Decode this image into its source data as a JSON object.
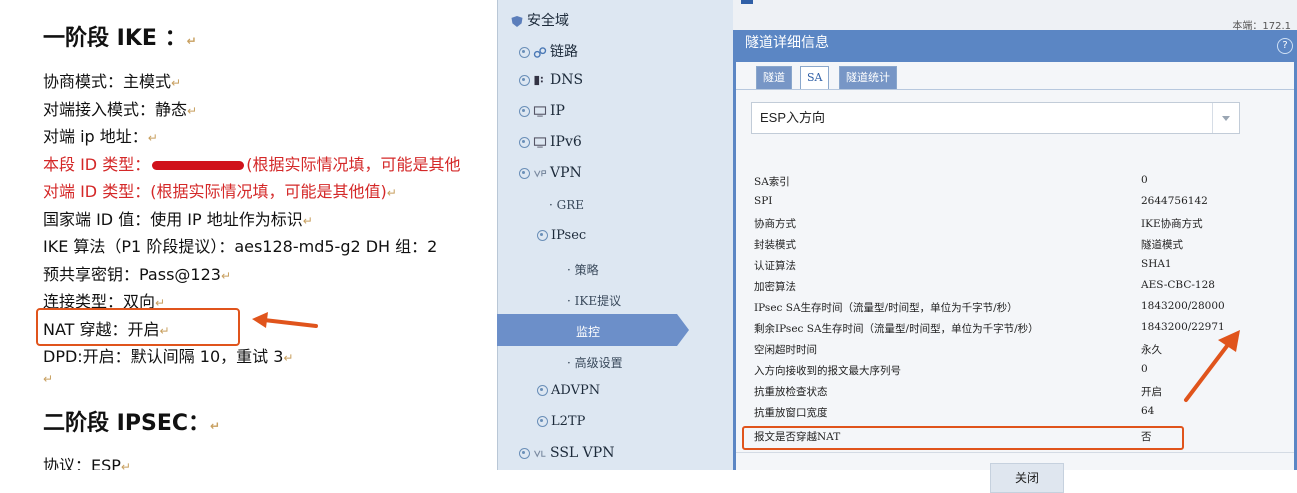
{
  "document": {
    "heading1": "一阶段 IKE ：",
    "lines": [
      "协商模式：主模式",
      "对端接入模式：静态",
      "对端 ip 地址：",
      "本段 ID 类型：",
      "(根据实际情况填，可能是其他",
      "对端 ID 类型：(根据实际情况填，可能是其他值)",
      "国家端 ID 值：使用 IP 地址作为标识",
      "IKE 算法（P1 阶段提议）：aes128-md5-g2   DH 组：2",
      "预共享密钥：Pass@123",
      "连接类型：双向",
      "NAT 穿越：开启",
      "DPD:开启：默认间隔 10，重试 3"
    ],
    "heading2": "二阶段 IPSEC：",
    "protocol_line": "协议：ESP",
    "paragraph_mark": "↵"
  },
  "nav": {
    "items": [
      {
        "label": "安全域",
        "icon": "shield-icon"
      },
      {
        "label": "链路",
        "icon": "link-icon"
      },
      {
        "label": "DNS",
        "icon": "dns-icon"
      },
      {
        "label": "IP",
        "icon": "ip-icon"
      },
      {
        "label": "IPv6",
        "icon": "ipv6-icon"
      },
      {
        "label": "VPN",
        "icon": "vpn-icon"
      },
      {
        "label": "GRE"
      },
      {
        "label": "IPsec"
      },
      {
        "label": "策略"
      },
      {
        "label": "IKE提议"
      },
      {
        "label": "监控"
      },
      {
        "label": "高级设置"
      },
      {
        "label": "ADVPN"
      },
      {
        "label": "L2TP"
      },
      {
        "label": "SSL VPN",
        "icon": "sslvpn-icon"
      }
    ],
    "active": "监控"
  },
  "background": {
    "local_label": "本端：172.1"
  },
  "dialog": {
    "title": "隧道详细信息",
    "help": "?",
    "tabs": [
      {
        "label": "隧道",
        "active": false
      },
      {
        "label": "SA",
        "active": true
      },
      {
        "label": "隧道统计",
        "active": false
      }
    ],
    "direction_select": "ESP入方向",
    "rows": [
      {
        "key": "SA索引",
        "value": "0"
      },
      {
        "key": "SPI",
        "value": "2644756142"
      },
      {
        "key": "协商方式",
        "value": "IKE协商方式"
      },
      {
        "key": "封装模式",
        "value": "隧道模式"
      },
      {
        "key": "认证算法",
        "value": "SHA1"
      },
      {
        "key": "加密算法",
        "value": "AES-CBC-128"
      },
      {
        "key": "IPsec SA生存时间（流量型/时间型，单位为千字节/秒）",
        "value": "1843200/28000"
      },
      {
        "key": "剩余IPsec SA生存时间（流量型/时间型，单位为千字节/秒）",
        "value": "1843200/22971"
      },
      {
        "key": "空闲超时时间",
        "value": "永久"
      },
      {
        "key": "入方向接收到的报文最大序列号",
        "value": "0"
      },
      {
        "key": "抗重放检查状态",
        "value": "开启"
      },
      {
        "key": "抗重放窗口宽度",
        "value": "64"
      },
      {
        "key": "报文是否穿越NAT",
        "value": "否"
      }
    ],
    "close_label": "关闭"
  },
  "colors": {
    "highlight": "#e0541c",
    "title_bar": "#5b86c4",
    "nav_active": "#6c8fc9",
    "red_text": "#d42828"
  }
}
